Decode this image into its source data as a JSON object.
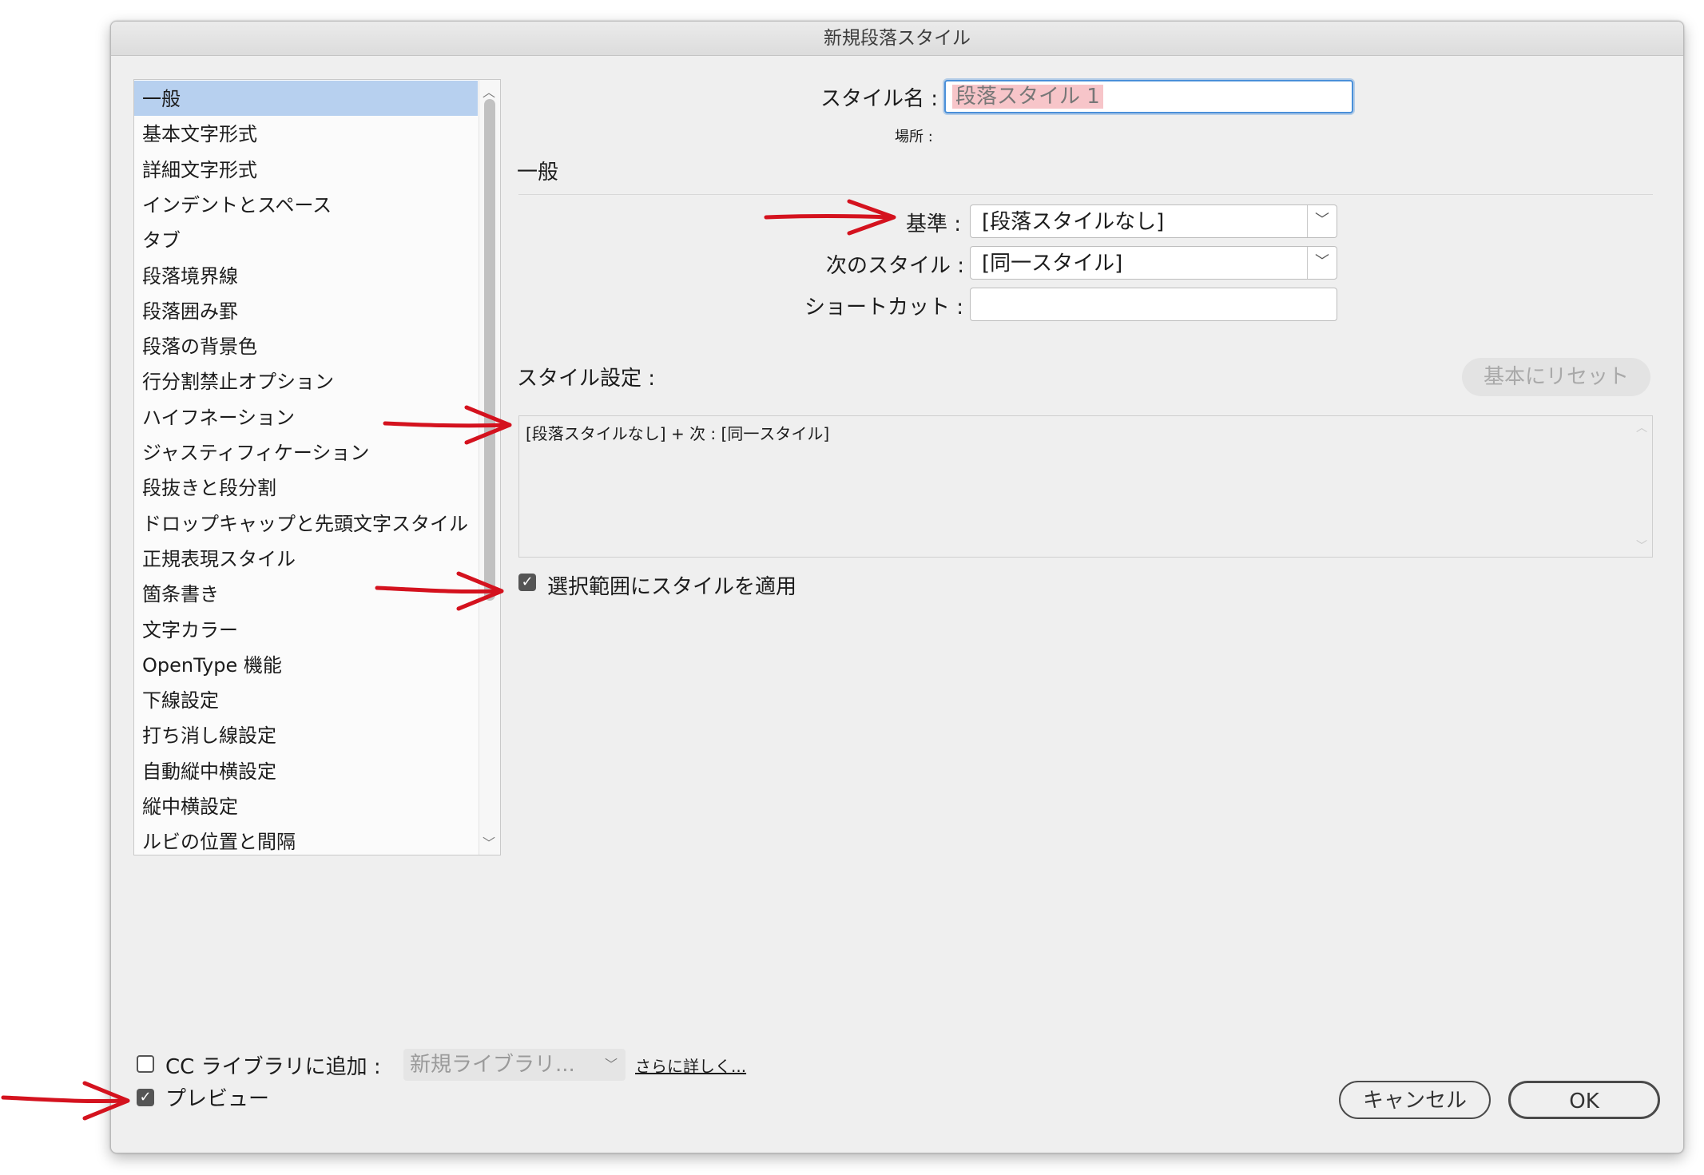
{
  "window": {
    "title": "新規段落スタイル"
  },
  "categories": [
    {
      "label": "一般",
      "selected": true
    },
    {
      "label": "基本文字形式"
    },
    {
      "label": "詳細文字形式"
    },
    {
      "label": "インデントとスペース"
    },
    {
      "label": "タブ"
    },
    {
      "label": "段落境界線"
    },
    {
      "label": "段落囲み罫"
    },
    {
      "label": "段落の背景色"
    },
    {
      "label": "行分割禁止オプション"
    },
    {
      "label": "ハイフネーション"
    },
    {
      "label": "ジャスティフィケーション"
    },
    {
      "label": "段抜きと段分割"
    },
    {
      "label": "ドロップキャップと先頭文字スタイル"
    },
    {
      "label": "正規表現スタイル"
    },
    {
      "label": "箇条書き"
    },
    {
      "label": "文字カラー"
    },
    {
      "label": "OpenType 機能"
    },
    {
      "label": "下線設定"
    },
    {
      "label": "打ち消し線設定"
    },
    {
      "label": "自動縦中横設定"
    },
    {
      "label": "縦中横設定"
    },
    {
      "label": "ルビの位置と間隔"
    }
  ],
  "style_name": {
    "label": "スタイル名 :",
    "value": "段落スタイル 1"
  },
  "location": {
    "label": "場所 :"
  },
  "section_title": "一般",
  "based_on": {
    "label": "基準 :",
    "value": "[段落スタイルなし]"
  },
  "next_style": {
    "label": "次のスタイル :",
    "value": "[同一スタイル]"
  },
  "shortcut": {
    "label": "ショートカット :",
    "value": ""
  },
  "style_settings": {
    "label": "スタイル設定 :",
    "reset_button": "基本にリセット",
    "summary": "[段落スタイルなし] + 次 : [同一スタイル]"
  },
  "apply_to_selection": {
    "label": "選択範囲にスタイルを適用",
    "checked": true
  },
  "cc_library": {
    "label": "CC ライブラリに追加 :",
    "checked": false,
    "select_value": "新規ライブラリ...",
    "link": "さらに詳しく..."
  },
  "preview": {
    "label": "プレビュー",
    "checked": true
  },
  "buttons": {
    "cancel": "キャンセル",
    "ok": "OK"
  },
  "annotation_color": "#d4121e"
}
